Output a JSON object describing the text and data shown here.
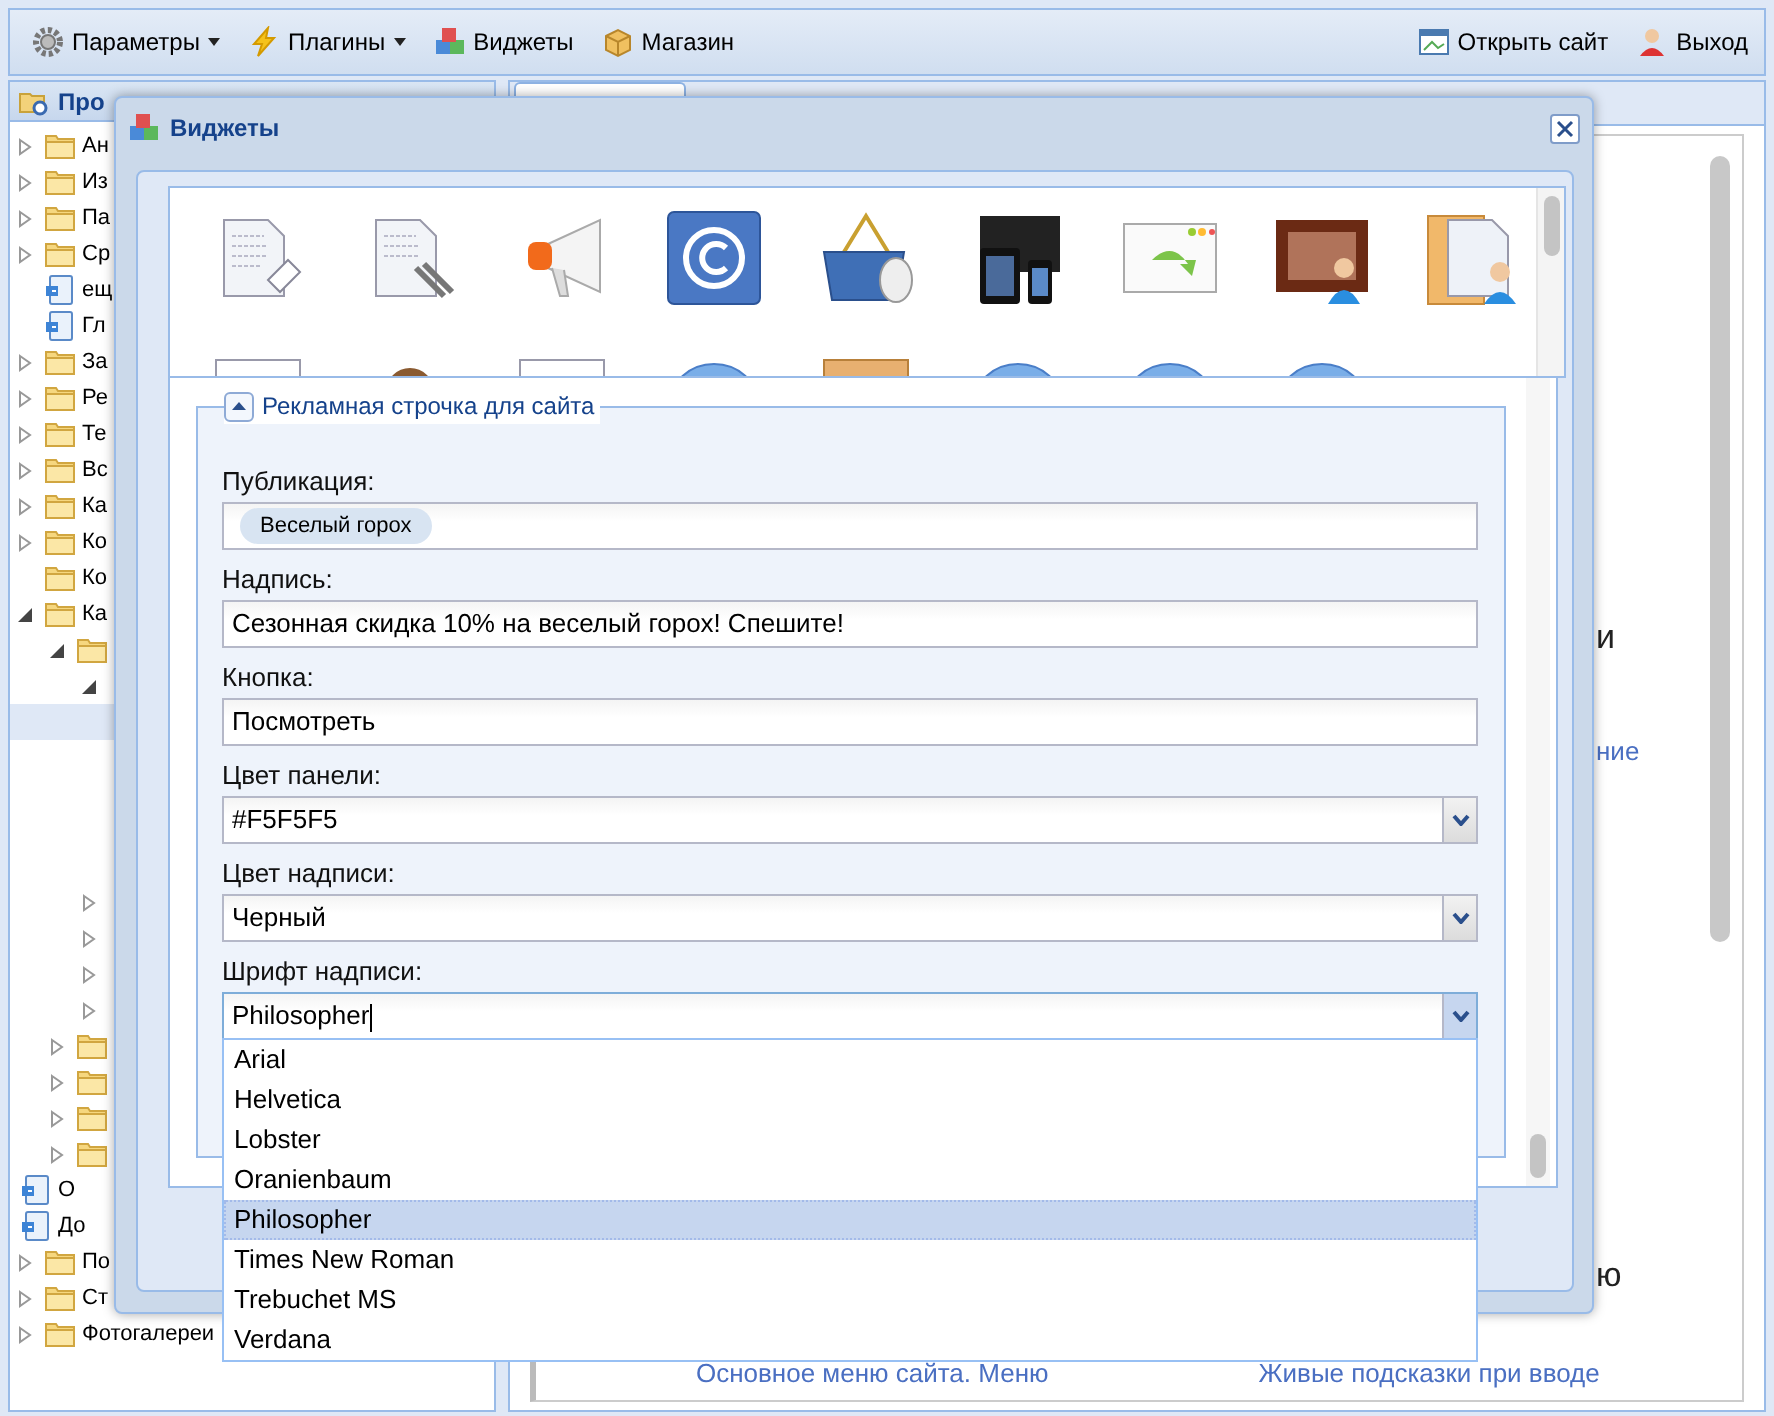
{
  "toolbar": {
    "left": [
      {
        "label": "Параметры",
        "kind": "gear",
        "dropdown": true
      },
      {
        "label": "Плагины",
        "kind": "bolt",
        "dropdown": true
      },
      {
        "label": "Виджеты",
        "kind": "cubes",
        "dropdown": false
      },
      {
        "label": "Магазин",
        "kind": "box",
        "dropdown": false
      }
    ],
    "right": [
      {
        "label": "Открыть сайт",
        "kind": "window"
      },
      {
        "label": "Выход",
        "kind": "user"
      }
    ]
  },
  "sidebar": {
    "title": "Про",
    "tree": [
      {
        "label": "Ан",
        "kind": "folder",
        "expanded": false,
        "selected": false
      },
      {
        "label": "Из",
        "kind": "folder",
        "expanded": false,
        "selected": false
      },
      {
        "label": "Па",
        "kind": "folder",
        "expanded": false,
        "selected": false
      },
      {
        "label": "Ср",
        "kind": "folder",
        "expanded": false,
        "selected": false
      },
      {
        "label": "ещ",
        "kind": "page",
        "selected": false
      },
      {
        "label": "Гл",
        "kind": "page",
        "selected": false
      },
      {
        "label": "За",
        "kind": "folder",
        "expanded": false,
        "selected": false
      },
      {
        "label": "Ре",
        "kind": "folder",
        "expanded": false,
        "selected": false
      },
      {
        "label": "Те",
        "kind": "folder",
        "expanded": false,
        "selected": false
      },
      {
        "label": "Вс",
        "kind": "folder",
        "expanded": false,
        "selected": false
      },
      {
        "label": "Ка",
        "kind": "folder",
        "expanded": false,
        "selected": false
      },
      {
        "label": "Ко",
        "kind": "folder",
        "expanded": false,
        "selected": false
      },
      {
        "label": "Ко",
        "kind": "folder",
        "selected": false
      },
      {
        "label": "Ка",
        "kind": "folder",
        "expanded": true,
        "selected": false,
        "children": [
          {
            "kind": "folder",
            "expanded": true,
            "selected": false,
            "children": [
              {
                "expanded": true,
                "selected": false,
                "children": [
                  {
                    "selected": true
                  },
                  {
                    "selected": false
                  },
                  {
                    "selected": false
                  },
                  {
                    "selected": false
                  },
                  {
                    "selected": false
                  }
                ]
              },
              {
                "expanded": false,
                "selected": false
              },
              {
                "expanded": false,
                "selected": false
              },
              {
                "expanded": false,
                "selected": false
              },
              {
                "expanded": false,
                "selected": false
              }
            ]
          },
          {
            "kind": "folder",
            "expanded": false,
            "selected": false
          },
          {
            "kind": "folder",
            "expanded": false,
            "selected": false
          },
          {
            "kind": "folder",
            "expanded": false,
            "selected": false
          },
          {
            "kind": "folder",
            "expanded": false,
            "selected": false
          },
          {
            "label": "О",
            "kind": "page",
            "selected": false
          },
          {
            "label": "До",
            "kind": "page",
            "selected": false
          }
        ]
      },
      {
        "label": "По",
        "kind": "folder",
        "expanded": false,
        "selected": false
      },
      {
        "label": "Ст",
        "kind": "folder",
        "expanded": false,
        "selected": false
      },
      {
        "label": "Фотогалереи",
        "kind": "folder",
        "expanded": false,
        "selected": false
      }
    ]
  },
  "content": {
    "fragments": [
      {
        "text": "и",
        "kind": "heading"
      },
      {
        "text": "ние",
        "kind": "link"
      },
      {
        "text": "ю",
        "kind": "heading"
      }
    ],
    "footer_links": [
      "Основное меню сайта. Меню",
      "Живые подсказки при вводе"
    ]
  },
  "dialog": {
    "title": "Виджеты",
    "gallery": [
      {
        "kind": "doc-tag"
      },
      {
        "kind": "doc-clip"
      },
      {
        "kind": "megaphone"
      },
      {
        "kind": "copyright"
      },
      {
        "kind": "basket"
      },
      {
        "kind": "devices"
      },
      {
        "kind": "window-arrow"
      },
      {
        "kind": "film-person"
      },
      {
        "kind": "folder-person"
      },
      {
        "kind": "sheet"
      },
      {
        "kind": "head"
      },
      {
        "kind": "sheet"
      },
      {
        "kind": "bubble"
      },
      {
        "kind": "crate"
      },
      {
        "kind": "bubble"
      },
      {
        "kind": "bubble"
      },
      {
        "kind": "bubble"
      }
    ],
    "section": {
      "title": "Рекламная строчка для сайта",
      "expanded": true
    },
    "fields": [
      {
        "label": "Публикация:",
        "kind": "tags",
        "tags": [
          "Веселый горох"
        ]
      },
      {
        "label": "Надпись:",
        "kind": "text",
        "value": "Сезонная скидка 10% на веселый горох! Спешите!"
      },
      {
        "label": "Кнопка:",
        "kind": "text",
        "value": "Посмотреть"
      },
      {
        "label": "Цвет панели:",
        "kind": "combo",
        "value": "#F5F5F5"
      },
      {
        "label": "Цвет надписи:",
        "kind": "combo",
        "value": "Черный"
      },
      {
        "label": "Шрифт надписи:",
        "kind": "combo",
        "value": "Philosopher",
        "open": true,
        "options": [
          {
            "label": "Arial",
            "selected": false
          },
          {
            "label": "Helvetica",
            "selected": false
          },
          {
            "label": "Lobster",
            "selected": false
          },
          {
            "label": "Oranienbaum",
            "selected": false
          },
          {
            "label": "Philosopher",
            "selected": true
          },
          {
            "label": "Times New Roman",
            "selected": false
          },
          {
            "label": "Trebuchet MS",
            "selected": false
          },
          {
            "label": "Verdana",
            "selected": false
          }
        ]
      }
    ]
  }
}
